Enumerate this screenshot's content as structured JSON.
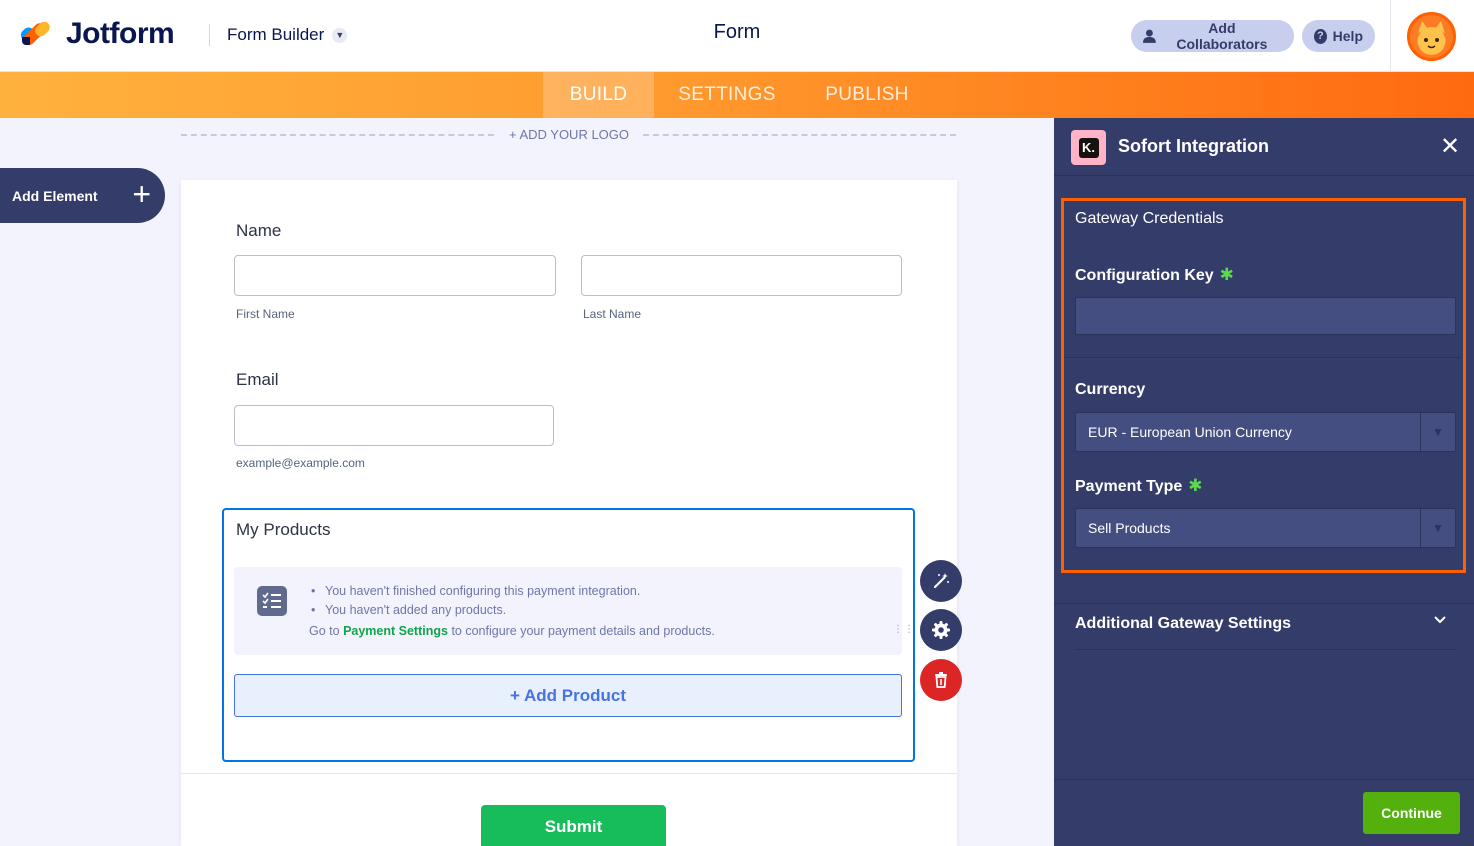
{
  "header": {
    "brand": "Jotform",
    "form_builder_label": "Form Builder",
    "title": "Form",
    "add_collaborators_label": "Add Collaborators",
    "help_label": "Help"
  },
  "nav": {
    "tabs": [
      {
        "label": "BUILD",
        "active": true
      },
      {
        "label": "SETTINGS",
        "active": false
      },
      {
        "label": "PUBLISH",
        "active": false
      }
    ]
  },
  "canvas": {
    "add_logo_label": "+ ADD YOUR LOGO",
    "add_element_label": "Add Element"
  },
  "form": {
    "name": {
      "label": "Name",
      "first_sublabel": "First Name",
      "last_sublabel": "Last Name",
      "first_value": "",
      "last_value": ""
    },
    "email": {
      "label": "Email",
      "sublabel": "example@example.com",
      "value": ""
    },
    "products": {
      "label": "My Products",
      "notice_items": [
        "You haven't finished configuring this payment integration.",
        "You haven't added any products."
      ],
      "goto_prefix": "Go to",
      "goto_link": "Payment Settings",
      "goto_suffix": "to configure your payment details and products.",
      "add_product_label": "+ Add Product"
    },
    "submit_label": "Submit"
  },
  "panel": {
    "title": "Sofort Integration",
    "logo_letter": "K.",
    "section_title": "Gateway Credentials",
    "config_key_label": "Configuration Key",
    "config_key_value": "",
    "currency_label": "Currency",
    "currency_value": "EUR - European Union Currency",
    "payment_type_label": "Payment Type",
    "payment_type_value": "Sell Products",
    "required_mark": "✱",
    "additional_label": "Additional Gateway Settings",
    "continue_label": "Continue"
  },
  "colors": {
    "brand_navy": "#0a1551",
    "orange": "#ff6100",
    "panel_bg": "#343c6a",
    "submit_green": "#18bd5b",
    "continue_green": "#54b00d",
    "focus_blue": "#0075e3"
  }
}
